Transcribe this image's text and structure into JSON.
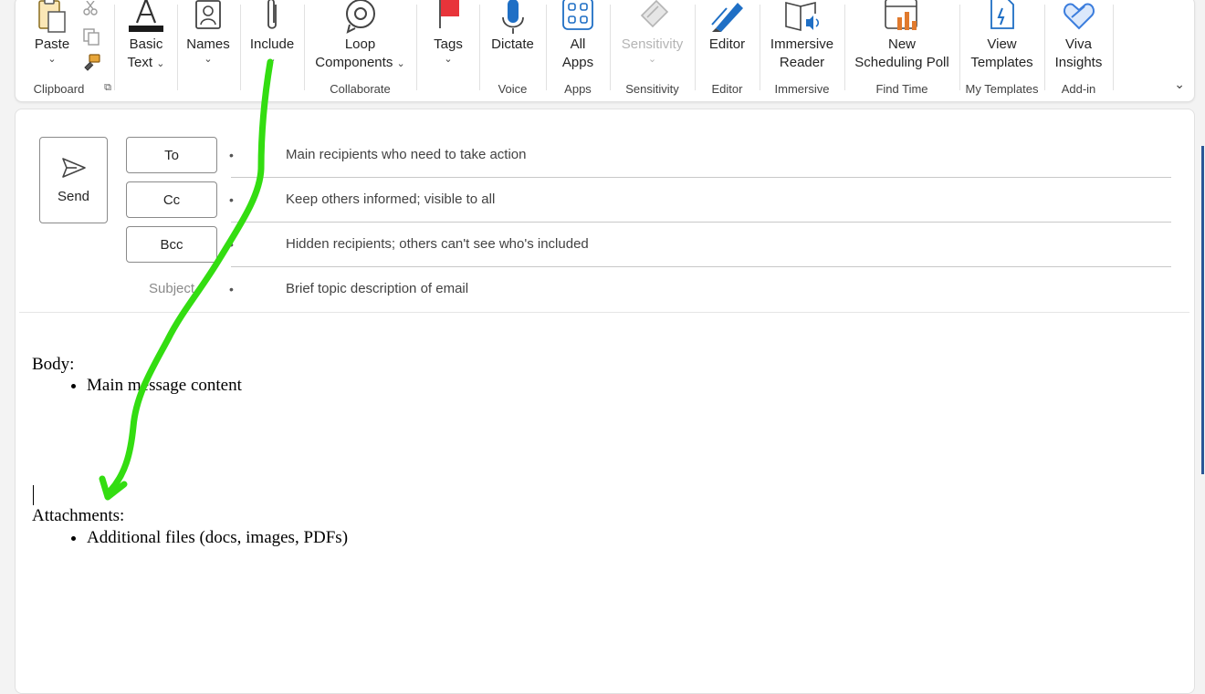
{
  "ribbon": {
    "clipboard": {
      "paste": "Paste",
      "group": "Clipboard"
    },
    "basic_text": {
      "line1": "Basic",
      "line2": "Text"
    },
    "names": {
      "label": "Names"
    },
    "include": {
      "label": "Include"
    },
    "collaborate": {
      "line1": "Loop",
      "line2": "Components",
      "group": "Collaborate"
    },
    "tags": {
      "label": "Tags"
    },
    "voice": {
      "label": "Dictate",
      "group": "Voice"
    },
    "apps": {
      "line1": "All",
      "line2": "Apps",
      "group": "Apps"
    },
    "sensitivity": {
      "label": "Sensitivity",
      "group": "Sensitivity"
    },
    "editor": {
      "label": "Editor",
      "group": "Editor"
    },
    "immersive": {
      "line1": "Immersive",
      "line2": "Reader",
      "group": "Immersive"
    },
    "find_time": {
      "line1": "New",
      "line2": "Scheduling Poll",
      "group": "Find Time"
    },
    "my_templates": {
      "line1": "View",
      "line2": "Templates",
      "group": "My Templates"
    },
    "addin": {
      "line1": "Viva",
      "line2": "Insights",
      "group": "Add-in"
    }
  },
  "compose": {
    "send": "Send",
    "to_label": "To",
    "cc_label": "Cc",
    "bcc_label": "Bcc",
    "subject_label": "Subject",
    "bullet": "•",
    "to_hint": "Main recipients who need to take action",
    "cc_hint": "Keep others informed; visible to all",
    "bcc_hint": "Hidden recipients; others can't see who's included",
    "subject_hint": "Brief topic description of email"
  },
  "body": {
    "body_heading": "Body:",
    "body_items": [
      "Main message content"
    ],
    "attachments_heading": "Attachments:",
    "attachments_items": [
      "Additional files (docs, images, PDFs)"
    ]
  },
  "colors": {
    "annotation_arrow": "#33dd11",
    "accent_blue": "#1f6fc5",
    "tag_red": "#e8343a"
  },
  "icons": [
    "paste-icon",
    "cut-icon",
    "copy-icon",
    "format-painter-icon",
    "font-icon",
    "address-book-icon",
    "paperclip-icon",
    "loop-icon",
    "flag-icon",
    "microphone-icon",
    "apps-grid-icon",
    "sensitivity-icon",
    "editor-pen-icon",
    "immersive-reader-icon",
    "scheduling-poll-icon",
    "templates-icon",
    "viva-insights-icon",
    "send-icon"
  ]
}
